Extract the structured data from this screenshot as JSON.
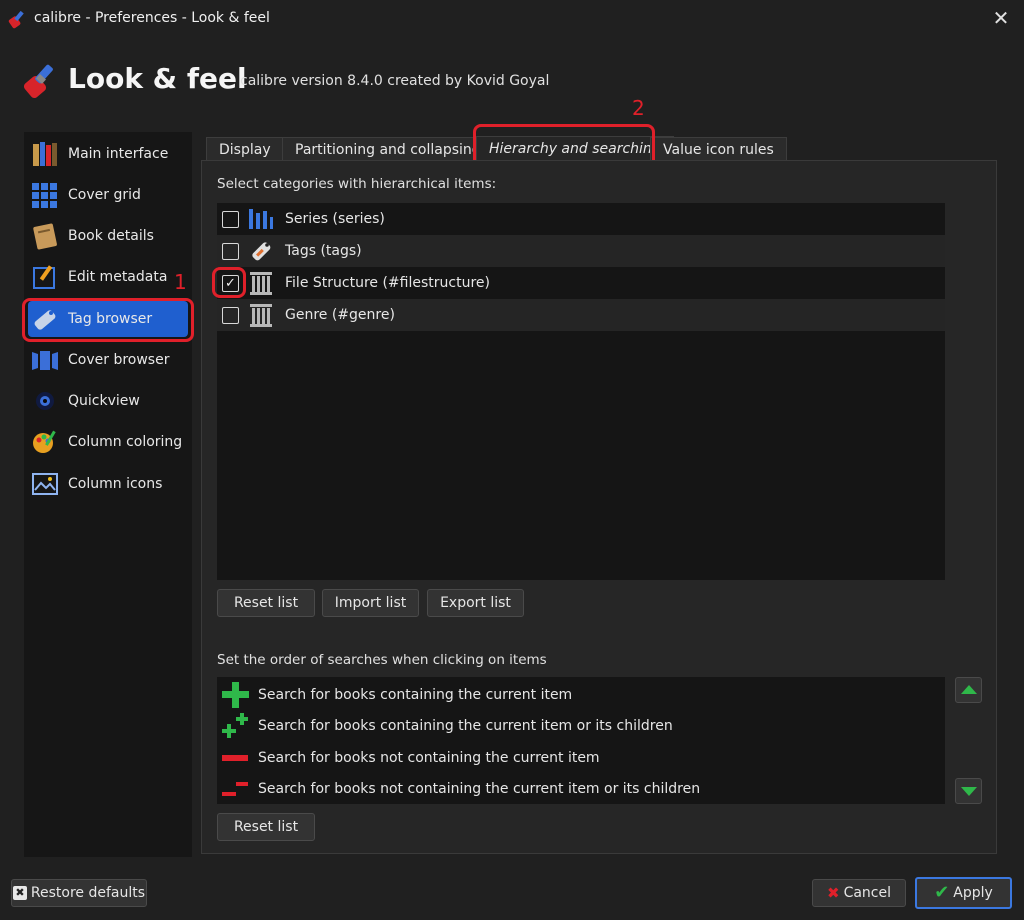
{
  "window": {
    "title": "calibre - Preferences - Look & feel"
  },
  "header": {
    "title": "Look & feel",
    "subtitle": "calibre version 8.4.0 created by Kovid Goyal"
  },
  "sidebar": {
    "items": [
      {
        "label": "Main interface",
        "icon": "books-icon"
      },
      {
        "label": "Cover grid",
        "icon": "grid-icon"
      },
      {
        "label": "Book details",
        "icon": "book-icon"
      },
      {
        "label": "Edit metadata",
        "icon": "edit-metadata-icon"
      },
      {
        "label": "Tag browser",
        "icon": "tag-icon",
        "selected": true
      },
      {
        "label": "Cover browser",
        "icon": "cover-browser-icon"
      },
      {
        "label": "Quickview",
        "icon": "eye-icon"
      },
      {
        "label": "Column coloring",
        "icon": "palette-icon"
      },
      {
        "label": "Column icons",
        "icon": "image-icon"
      }
    ]
  },
  "annotations": {
    "label1": "1",
    "label2": "2"
  },
  "tabs": [
    {
      "label": "Display"
    },
    {
      "label": "Partitioning and collapsing"
    },
    {
      "label": "Hierarchy and searching",
      "active": true
    },
    {
      "label": "Value icon rules"
    }
  ],
  "hierarchy": {
    "label": "Select categories with hierarchical items:",
    "items": [
      {
        "label": "Series (series)",
        "checked": false,
        "icon": "series-icon"
      },
      {
        "label": "Tags (tags)",
        "checked": false,
        "icon": "tag-icon"
      },
      {
        "label": "File Structure (#filestructure)",
        "checked": true,
        "icon": "column-icon"
      },
      {
        "label": "Genre (#genre)",
        "checked": false,
        "icon": "column-icon"
      }
    ],
    "buttons": {
      "reset": "Reset list",
      "import": "Import list",
      "export": "Export list"
    }
  },
  "search_order": {
    "label": "Set the order of searches when clicking on items",
    "items": [
      {
        "label": "Search for books containing the current item",
        "icon": "plus-icon"
      },
      {
        "label": "Search for books containing the current item or its children",
        "icon": "plus-plus-icon"
      },
      {
        "label": "Search for books not containing the current item",
        "icon": "minus-icon"
      },
      {
        "label": "Search for books not containing the current item or its children",
        "icon": "minus-minus-icon"
      }
    ],
    "reset_label": "Reset list"
  },
  "footer": {
    "restore_label": "Restore defaults",
    "cancel_label": "Cancel",
    "apply_label": "Apply"
  },
  "colors": {
    "accent": "#1f5fcf",
    "annotation": "#e0202a",
    "green": "#2fb84a",
    "red": "#e0202a"
  }
}
